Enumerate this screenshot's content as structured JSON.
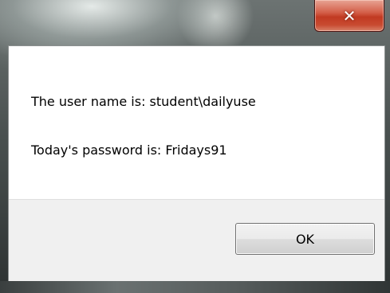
{
  "titlebar": {
    "close_glyph": "✕"
  },
  "message": {
    "line1": "The user name is: student\\dailyuse",
    "line2": "Today's password is: Fridays91"
  },
  "buttons": {
    "ok_label": "OK"
  },
  "colors": {
    "close_button": "#c13a22",
    "frame": "#4a5150",
    "button_bar": "#f0f0f0"
  }
}
